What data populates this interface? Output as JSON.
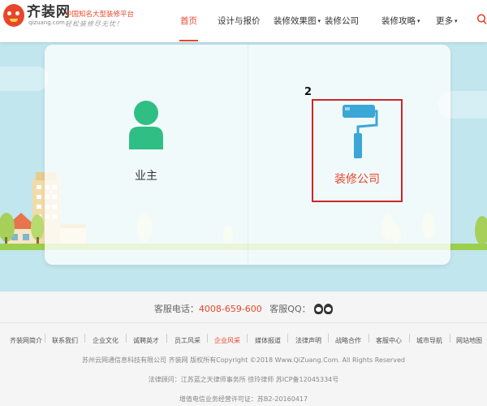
{
  "header": {
    "logo_name": "齐装网",
    "logo_domain": "qizuang.com",
    "slogan_main": "中国知名大型装修平台",
    "slogan_sub": "轻松装修尽无忧！"
  },
  "nav": {
    "items": [
      {
        "label": "首页",
        "active": true
      },
      {
        "label": "设计与报价"
      },
      {
        "label": "装修效果图",
        "caret": "▾"
      },
      {
        "label": "装修公司"
      },
      {
        "label": "装修攻略",
        "caret": "▾"
      },
      {
        "label": "更多",
        "caret": "▾"
      }
    ]
  },
  "roles": {
    "owner_label": "业主",
    "company_label": "装修公司",
    "annotation_number": "2"
  },
  "footer": {
    "service_prefix": "客服电话：",
    "service_phone": "4008-659-600",
    "qq_prefix": "客服QQ：",
    "links": [
      "齐装网简介",
      "联系我们",
      "企业文化",
      "诚聘英才",
      "员工风采",
      "企业风采",
      "媒体报道",
      "法律声明",
      "战略合作",
      "客服中心",
      "城市导航",
      "网站地图"
    ],
    "active_link": "企业风采",
    "copyright": "苏州云网通信息科技有限公司 齐装网 版权所有Copyright ©2018 Www.QiZuang.Com. All Rights Reserved",
    "legal": "法律顾问：江苏蓝之天律师事务所 徐玲律师 苏ICP备12045334号",
    "license": "增值电信业务经营许可证：苏B2-20160417"
  },
  "colors": {
    "accent": "#e8462b",
    "highlight_border": "#c92828",
    "owner_icon": "#2fbf84",
    "roller_icon": "#3aa7d6",
    "sky": "#c1e6ee"
  }
}
